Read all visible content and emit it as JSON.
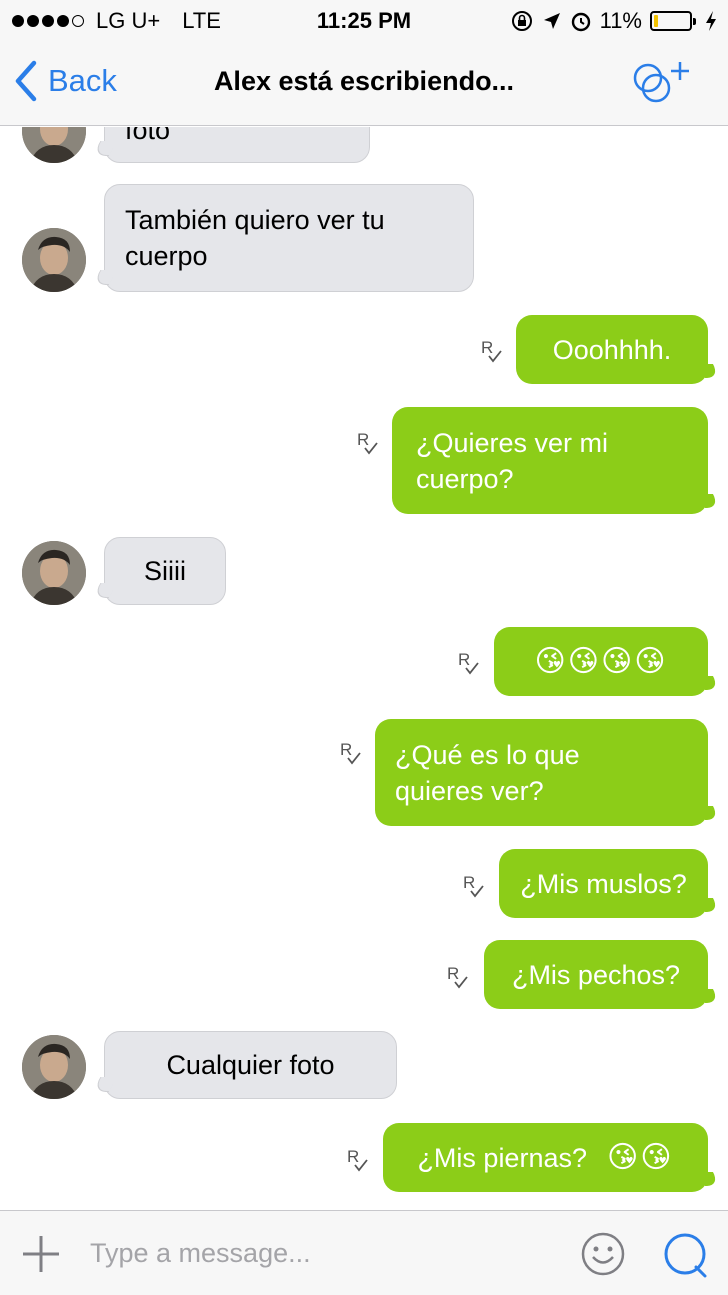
{
  "status_bar": {
    "carrier": "LG U+",
    "network": "LTE",
    "time": "11:25 PM",
    "battery_percent": "11%",
    "battery_level": 0.11,
    "icons": [
      "signal-dots-icon",
      "rotation-lock-icon",
      "location-arrow-icon",
      "alarm-icon",
      "battery-icon",
      "charging-bolt-icon"
    ]
  },
  "nav": {
    "back_label": "Back",
    "title": "Alex está escribiendo...",
    "accent": "#2b7ee8"
  },
  "messages": [
    {
      "dir": "in",
      "text": "Mandame una foto"
    },
    {
      "dir": "in",
      "text": "También quiero ver tu cuerpo",
      "lines": [
        "También quiero ver tu",
        "cuerpo"
      ]
    },
    {
      "dir": "out",
      "text": "Ooohhhh.",
      "receipt": "R"
    },
    {
      "dir": "out",
      "text": "¿Quieres ver mi cuerpo?",
      "lines": [
        "¿Quieres ver mi",
        "cuerpo?"
      ],
      "receipt": "R"
    },
    {
      "dir": "in",
      "text": "Siiii"
    },
    {
      "dir": "out",
      "text": "😘😘😘😘",
      "receipt": "R"
    },
    {
      "dir": "out",
      "text": "¿Qué es lo que quieres ver?",
      "lines": [
        "¿Qué es lo que",
        "quieres ver?"
      ],
      "receipt": "R"
    },
    {
      "dir": "out",
      "text": "¿Mis muslos?",
      "receipt": "R"
    },
    {
      "dir": "out",
      "text": "¿Mis pechos?",
      "receipt": "R"
    },
    {
      "dir": "in",
      "text": "Cualquier foto"
    },
    {
      "dir": "out",
      "text": "¿Mis piernas?",
      "emoji": "😘😘",
      "receipt": "R"
    }
  ],
  "composer": {
    "placeholder": "Type a message..."
  },
  "colors": {
    "outgoing_bubble": "#8ccd18",
    "incoming_bubble": "#e5e6ea",
    "battery_fill": "#f2c200"
  }
}
